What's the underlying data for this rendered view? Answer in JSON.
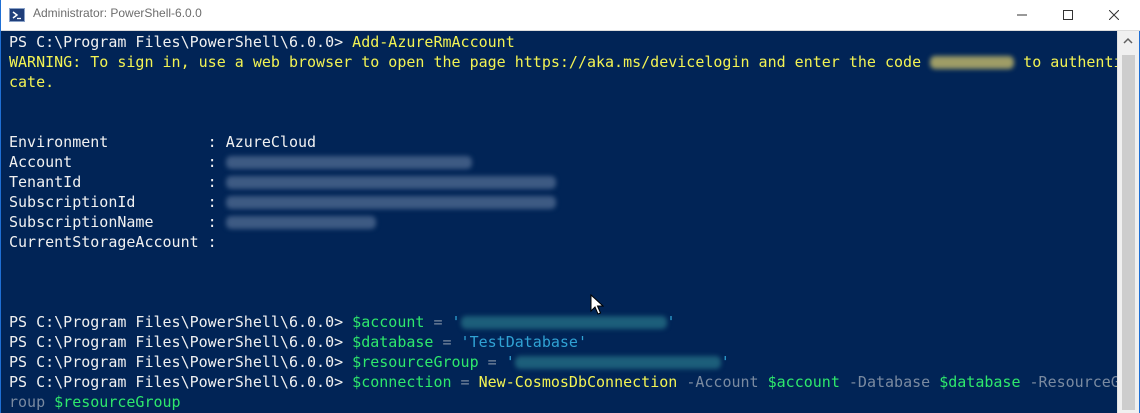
{
  "window": {
    "title": "Administrator: PowerShell-6.0.0"
  },
  "console": {
    "prompt": "PS C:\\Program Files\\PowerShell\\6.0.0> ",
    "line1": {
      "cmd": "Add-AzureRmAccount"
    },
    "warning": {
      "prefix": "WARNING: To sign in, use a web browser to open the page https://aka.ms/devicelogin and enter the code ",
      "suffix": " to authenti",
      "wrap": "cate."
    },
    "props": [
      {
        "key": "Environment           : ",
        "value": "AzureCloud"
      },
      {
        "key": "Account               : ",
        "value": ""
      },
      {
        "key": "TenantId              : ",
        "value": ""
      },
      {
        "key": "SubscriptionId        : ",
        "value": ""
      },
      {
        "key": "SubscriptionName      : ",
        "value": ""
      },
      {
        "key": "CurrentStorageAccount : ",
        "value": ""
      }
    ],
    "cmd_account": {
      "var": "$account",
      "eq": " = ",
      "q1": "'",
      "q2": "'"
    },
    "cmd_database": {
      "var": "$database",
      "eq": " = ",
      "str": "'TestDatabase'"
    },
    "cmd_rg": {
      "var": "$resourceGroup",
      "eq": " = ",
      "q1": "'",
      "q2": "'"
    },
    "cmd_conn": {
      "var": "$connection",
      "eq": " = ",
      "cmdlet": "New-CosmosDbConnection",
      "p1": " -Account ",
      "v1": "$account",
      "p2": " -Database ",
      "v2": "$database",
      "p3": " -ResourceG",
      "wrap_text": "roup ",
      "v3": "$resourceGroup"
    }
  },
  "colors": {
    "background": "#012456",
    "command": "#f3f353",
    "variable": "#2ee86c",
    "string": "#30a2d4",
    "parameter": "#7a8aa0",
    "text": "#f1f1f1"
  },
  "icons": [
    "powershell-app-icon",
    "minimize-icon",
    "maximize-icon",
    "close-icon",
    "scroll-up-arrow-icon",
    "mouse-cursor-icon"
  ]
}
